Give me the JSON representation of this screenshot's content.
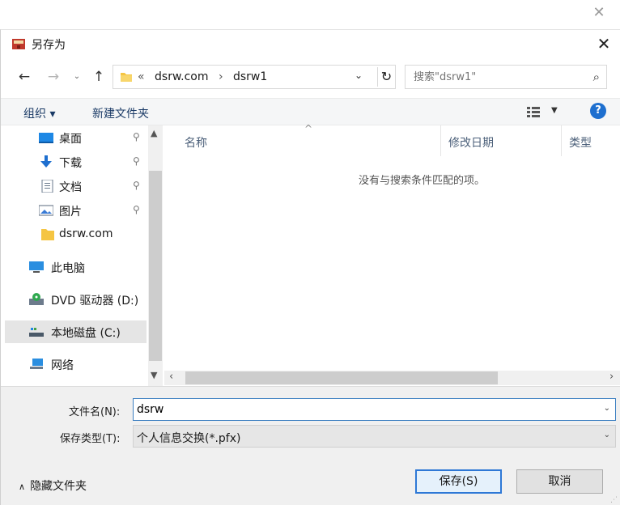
{
  "dialog": {
    "title": "另存为"
  },
  "address": {
    "prefix": "«",
    "segments": [
      "dsrw.com",
      "dsrw1"
    ],
    "separator": "›"
  },
  "search": {
    "placeholder": "搜索\"dsrw1\""
  },
  "toolbar": {
    "organize": "组织 ▾",
    "new_folder": "新建文件夹"
  },
  "sidebar": {
    "items": [
      {
        "label": "桌面",
        "icon": "desktop-icon",
        "pinned": true
      },
      {
        "label": "下载",
        "icon": "download-icon",
        "pinned": true
      },
      {
        "label": "文档",
        "icon": "document-icon",
        "pinned": true
      },
      {
        "label": "图片",
        "icon": "pictures-icon",
        "pinned": true
      },
      {
        "label": "dsrw.com",
        "icon": "folder-icon",
        "pinned": false
      },
      {
        "label": "此电脑",
        "icon": "computer-icon",
        "pinned": false
      },
      {
        "label": "DVD 驱动器 (D:)",
        "icon": "dvd-icon",
        "pinned": false
      },
      {
        "label": "本地磁盘 (C:)",
        "icon": "drive-icon",
        "pinned": false,
        "selected": true
      },
      {
        "label": "网络",
        "icon": "network-icon",
        "pinned": false
      }
    ]
  },
  "files": {
    "columns": [
      "名称",
      "修改日期",
      "类型"
    ],
    "empty_message": "没有与搜索条件匹配的项。"
  },
  "form": {
    "filename_label": "文件名(N):",
    "filename_value": "dsrw",
    "filetype_label": "保存类型(T):",
    "filetype_value": "个人信息交换(*.pfx)"
  },
  "footer": {
    "hide_folders": "隐藏文件夹",
    "save_label": "保存(S)",
    "cancel_label": "取消"
  },
  "colors": {
    "accent": "#2e78d6",
    "help": "#1e6fcf",
    "folder": "#f5c542"
  }
}
